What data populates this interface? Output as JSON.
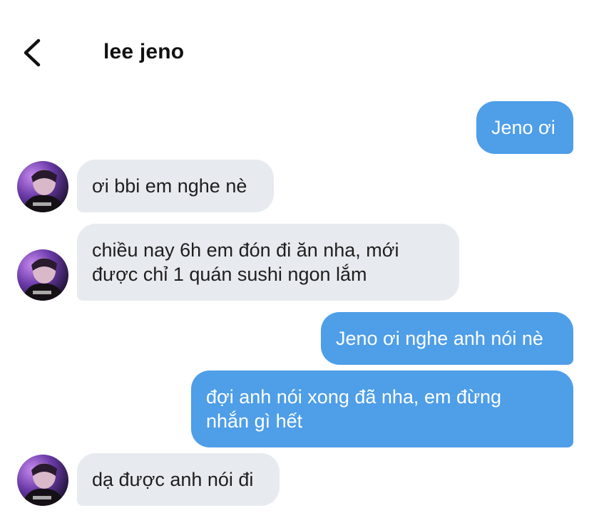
{
  "header": {
    "contact_name": "lee jeno",
    "back_icon": "chevron-left-icon"
  },
  "colors": {
    "outgoing_bubble": "#4e9ee8",
    "incoming_bubble": "#e7eaef",
    "text_dark": "#1f1f1f"
  },
  "messages": [
    {
      "direction": "outgoing",
      "text": "Jeno ơi"
    },
    {
      "direction": "incoming",
      "text": "ơi bbi em nghe nè"
    },
    {
      "direction": "incoming",
      "text": "chiều nay 6h em đón đi ăn nha, mới\nđược chỉ 1 quán sushi ngon lắm"
    },
    {
      "direction": "outgoing",
      "text": "Jeno ơi nghe anh nói nè"
    },
    {
      "direction": "outgoing",
      "text": "đợi anh nói xong đã nha, em đừng\nnhắn gì hết"
    },
    {
      "direction": "incoming",
      "text": "dạ được anh nói đi"
    }
  ]
}
